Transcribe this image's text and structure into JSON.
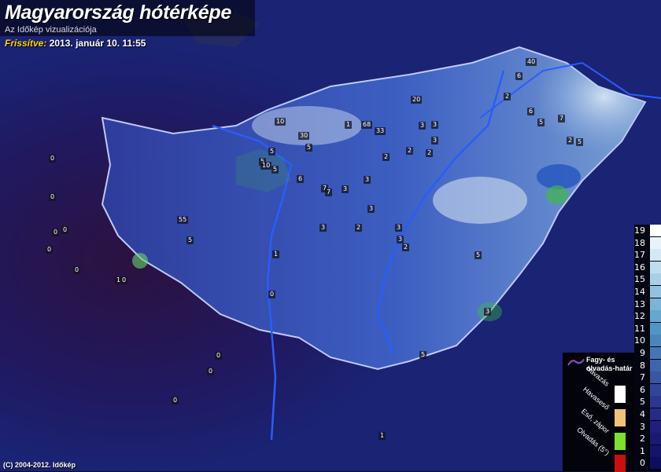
{
  "header": {
    "title": "Magyarország hótérképe",
    "subtitle": "Az Időkép vizualizációja",
    "updated_label": "Frissítve:",
    "updated_value": "2013. január 10. 11:55"
  },
  "footer": {
    "copyright": "(C) 2004-2012. Időkép"
  },
  "scale": {
    "labels": [
      "19",
      "18",
      "17",
      "16",
      "15",
      "14",
      "13",
      "12",
      "11",
      "10",
      "9",
      "8",
      "7",
      "6",
      "5",
      "4",
      "3",
      "2",
      "1",
      "0"
    ],
    "colors": [
      "#ffffff",
      "#e8f2fb",
      "#d4e8f6",
      "#c0dcef",
      "#a9cfe8",
      "#93c2e0",
      "#7cb4d8",
      "#66a6cf",
      "#5096c5",
      "#4a86bc",
      "#4476b3",
      "#3e66aa",
      "#3856a1",
      "#324698",
      "#2c388f",
      "#262b85",
      "#20207c",
      "#1a1a73",
      "#14146a",
      "#0e0e60"
    ]
  },
  "legend": {
    "boundary_label": "Fagy- és olvadás-határ",
    "categories": [
      {
        "label": "Havazás",
        "color": "#ffffff"
      },
      {
        "label": "Havaseső",
        "color": "#f2c27a"
      },
      {
        "label": "Eső, zápor",
        "color": "#7ee02a"
      },
      {
        "label": "Olvadás (5°)",
        "color": "#c81010"
      }
    ]
  },
  "stations": [
    "40",
    "6",
    "2",
    "6",
    "5",
    "7",
    "2",
    "5",
    "20",
    "10",
    "1",
    "68",
    "33",
    "3",
    "3",
    "3",
    "2",
    "30",
    "5",
    "5",
    "5",
    "10",
    "5",
    "6",
    "7",
    "7",
    "3",
    "3",
    "2",
    "2",
    "55",
    "5",
    "0",
    "0",
    "0",
    "0",
    "0",
    "1",
    "0",
    "0",
    "0",
    "1",
    "3",
    "5",
    "3",
    "3",
    "3",
    "2",
    "3",
    "2",
    "5",
    "1",
    "0",
    "0",
    "0"
  ]
}
